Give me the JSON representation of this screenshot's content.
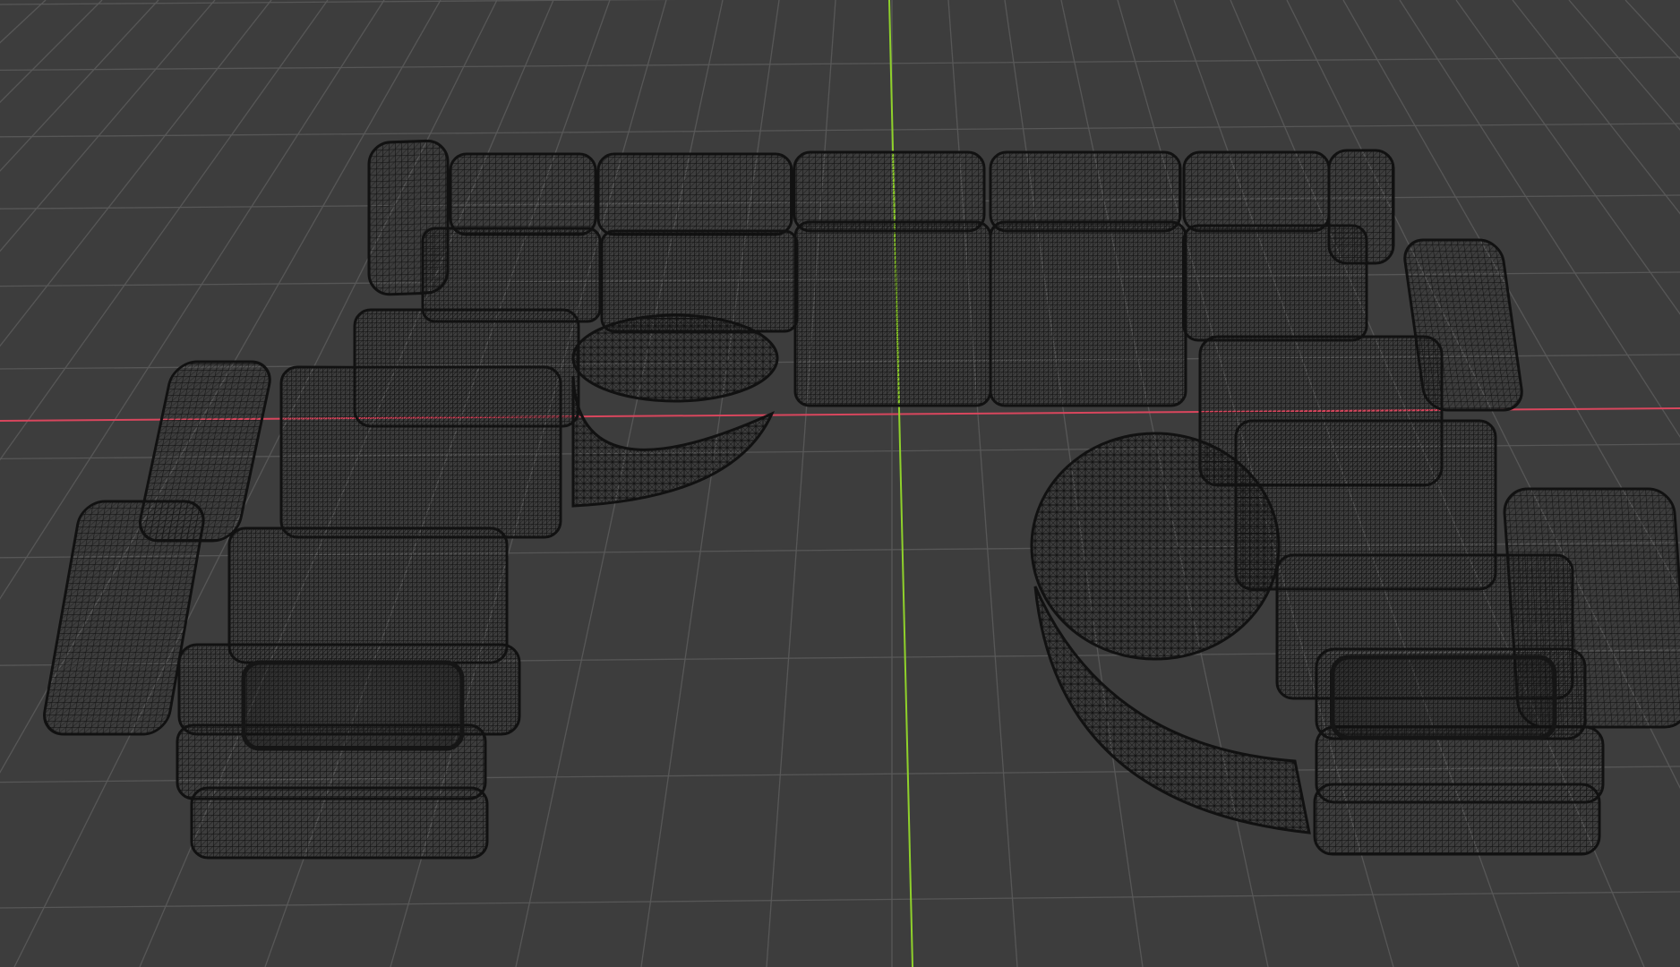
{
  "viewport": {
    "mode": "wireframe",
    "background_color": "#3d3d3d",
    "grid_color": "#5a5a5a",
    "x_axis_color": "#d8465d",
    "y_axis_color": "#8fd12b",
    "wire_color": "#111111",
    "object": {
      "name": "sectional-sofa-wireframe",
      "description_visible": false
    }
  }
}
